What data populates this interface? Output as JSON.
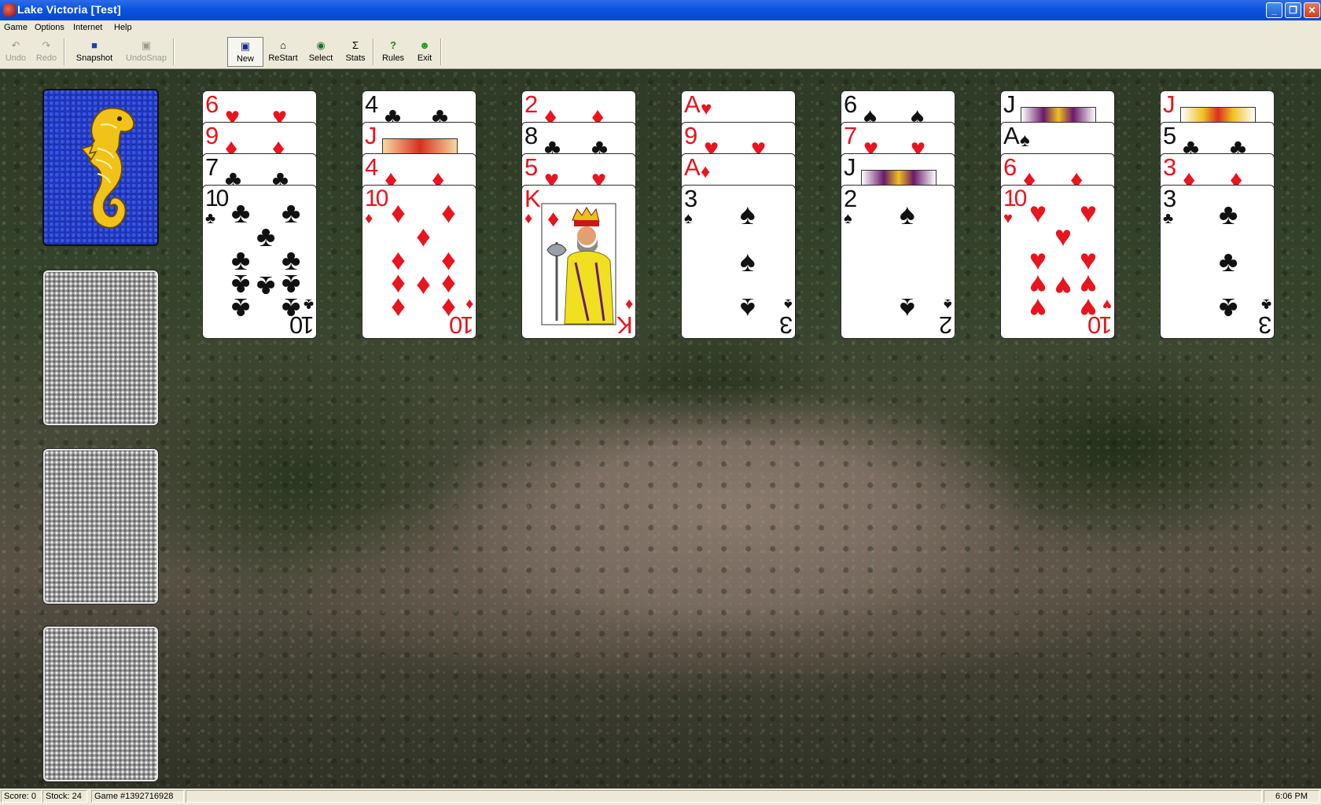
{
  "window": {
    "title": "Lake Victoria [Test]"
  },
  "menu": [
    "Game",
    "Options",
    "Internet",
    "Help"
  ],
  "toolbar": {
    "undo": "Undo",
    "redo": "Redo",
    "snapshot": "Snapshot",
    "undosnap": "UndoSnap",
    "new": "New",
    "restart": "ReStart",
    "select": "Select",
    "stats": "Stats",
    "rules": "Rules",
    "exit": "Exit"
  },
  "tableau": [
    {
      "cards": [
        {
          "rank": "6",
          "suit": "hearts"
        },
        {
          "rank": "9",
          "suit": "diamonds"
        },
        {
          "rank": "7",
          "suit": "clubs"
        },
        {
          "rank": "10",
          "suit": "clubs"
        }
      ]
    },
    {
      "cards": [
        {
          "rank": "4",
          "suit": "clubs"
        },
        {
          "rank": "J",
          "suit": "hearts"
        },
        {
          "rank": "4",
          "suit": "diamonds"
        },
        {
          "rank": "10",
          "suit": "diamonds"
        }
      ]
    },
    {
      "cards": [
        {
          "rank": "2",
          "suit": "diamonds"
        },
        {
          "rank": "8",
          "suit": "clubs"
        },
        {
          "rank": "5",
          "suit": "hearts"
        },
        {
          "rank": "K",
          "suit": "diamonds"
        }
      ]
    },
    {
      "cards": [
        {
          "rank": "A",
          "suit": "hearts"
        },
        {
          "rank": "9",
          "suit": "hearts"
        },
        {
          "rank": "A",
          "suit": "diamonds"
        },
        {
          "rank": "3",
          "suit": "spades"
        }
      ]
    },
    {
      "cards": [
        {
          "rank": "6",
          "suit": "spades"
        },
        {
          "rank": "7",
          "suit": "hearts"
        },
        {
          "rank": "J",
          "suit": "spades"
        },
        {
          "rank": "2",
          "suit": "spades"
        }
      ]
    },
    {
      "cards": [
        {
          "rank": "J",
          "suit": "spades"
        },
        {
          "rank": "A",
          "suit": "spades"
        },
        {
          "rank": "6",
          "suit": "diamonds"
        },
        {
          "rank": "10",
          "suit": "hearts"
        }
      ]
    },
    {
      "cards": [
        {
          "rank": "J",
          "suit": "diamonds"
        },
        {
          "rank": "5",
          "suit": "clubs"
        },
        {
          "rank": "3",
          "suit": "diamonds"
        },
        {
          "rank": "3",
          "suit": "clubs"
        }
      ]
    }
  ],
  "status": {
    "score": "Score:  0",
    "stock": "Stock: 24",
    "game": "Game #1392716928",
    "time": "6:06 PM"
  },
  "colors": {
    "titlebar": "#0a54e0",
    "red_suit": "#e8141e",
    "black_suit": "#111111",
    "stock_back": "#1d36c2"
  }
}
